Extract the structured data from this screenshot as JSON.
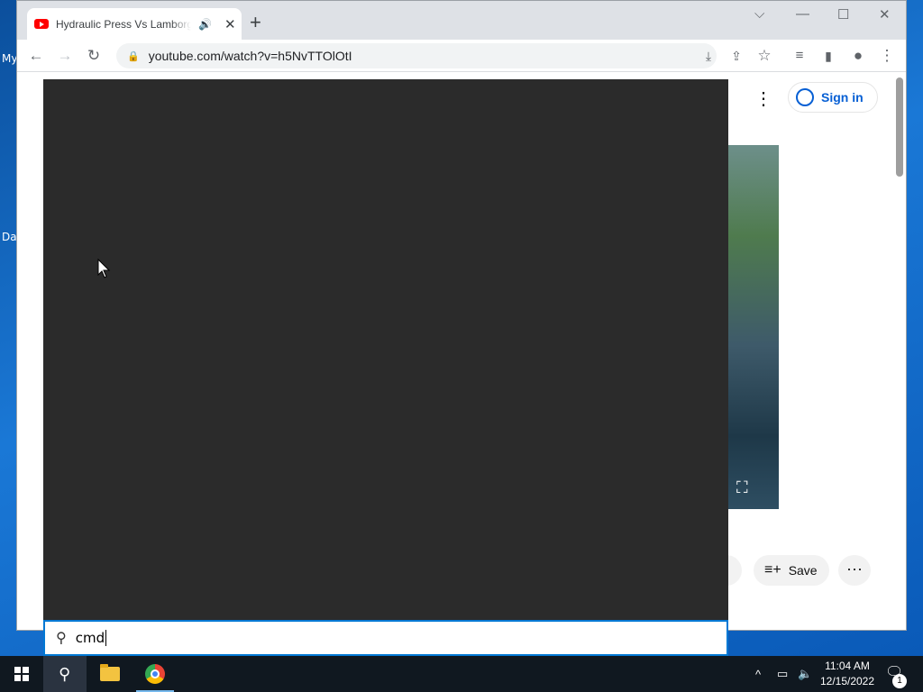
{
  "browser": {
    "tab": {
      "title": "Hydraulic Press Vs Lamborghini",
      "audio_icon": "speaker-icon",
      "close": "✕"
    },
    "new_tab": "+",
    "window_controls": {
      "tab_search": "⌵",
      "minimize": "—",
      "maximize": "☐",
      "close": "✕"
    },
    "toolbar": {
      "back": "←",
      "forward": "→",
      "reload": "↻"
    },
    "address": {
      "url": "youtube.com/watch?v=h5NvTTOlOtI",
      "secure_icon": "lock-icon"
    }
  },
  "youtube": {
    "menu": "⋮",
    "sign_in": "Sign in",
    "actions": {
      "save": "Save",
      "more": "···"
    }
  },
  "search": {
    "query": "cmd"
  },
  "taskbar": {
    "items": [
      "start-button",
      "search-button",
      "file-explorer",
      "google-chrome"
    ],
    "tray": {
      "chevron": "^",
      "time": "11:04 AM",
      "date": "12/15/2022",
      "notification_count": "1"
    }
  },
  "desktop": {
    "icon_labels": [
      "My",
      "Da"
    ]
  },
  "colors": {
    "accent": "#0078d4",
    "youtube_link": "#065fd4",
    "taskbar": "#101820",
    "search_panel": "#2b2b2b"
  }
}
